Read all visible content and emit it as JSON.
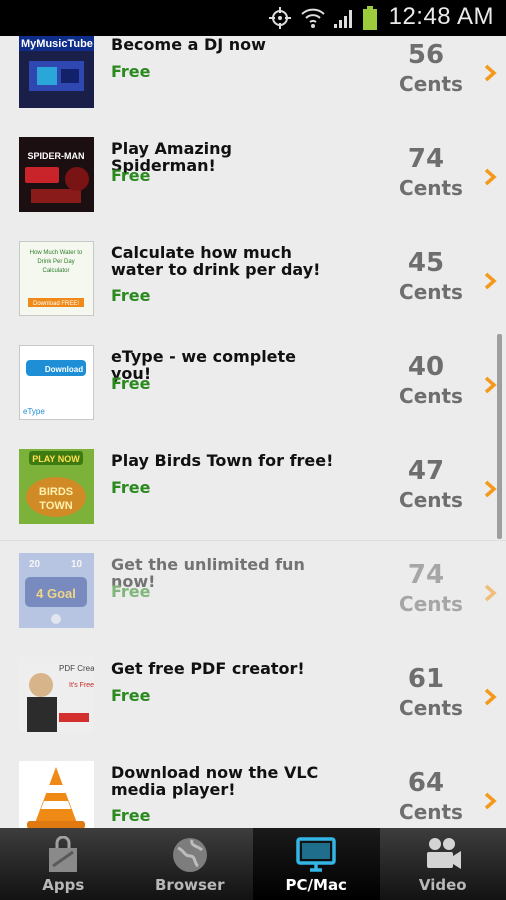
{
  "status_bar": {
    "time": "12:48 AM"
  },
  "offers": [
    {
      "title": "Become a DJ now",
      "price": "Free",
      "cost": "56",
      "unit": "Cents",
      "thumb_text": "MyMusicTube"
    },
    {
      "title": "Play Amazing Spiderman!",
      "price": "Free",
      "cost": "74",
      "unit": "Cents",
      "thumb_text": "SPIDER-MAN"
    },
    {
      "title": "Calculate how much water to drink per day!",
      "price": "Free",
      "cost": "45",
      "unit": "Cents",
      "thumb_text": "How Much Water to Drink Per Day Calculator"
    },
    {
      "title": "eType - we complete you!",
      "price": "Free",
      "cost": "40",
      "unit": "Cents",
      "thumb_text": "eType"
    },
    {
      "title": "Play Birds Town for free!",
      "price": "Free",
      "cost": "47",
      "unit": "Cents",
      "thumb_text": "PLAY NOW"
    },
    {
      "title": "Get the unlimited fun now!",
      "price": "Free",
      "cost": "74",
      "unit": "Cents",
      "thumb_text": "4 Goal"
    },
    {
      "title": "Get free PDF creator!",
      "price": "Free",
      "cost": "61",
      "unit": "Cents",
      "thumb_text": "PDF Creator"
    },
    {
      "title": "Download now the VLC media player!",
      "price": "Free",
      "cost": "64",
      "unit": "Cents",
      "thumb_text": ""
    }
  ],
  "tabs": [
    {
      "label": "Apps",
      "icon": "apps-icon",
      "active": false
    },
    {
      "label": "Browser",
      "icon": "globe-icon",
      "active": false
    },
    {
      "label": "PC/Mac",
      "icon": "monitor-icon",
      "active": true
    },
    {
      "label": "Video",
      "icon": "video-camera-icon",
      "active": false
    }
  ],
  "colors": {
    "price_green": "#2b8a1f",
    "accent_orange": "#f39a1e",
    "active_tab_icon": "#33b5e5"
  }
}
